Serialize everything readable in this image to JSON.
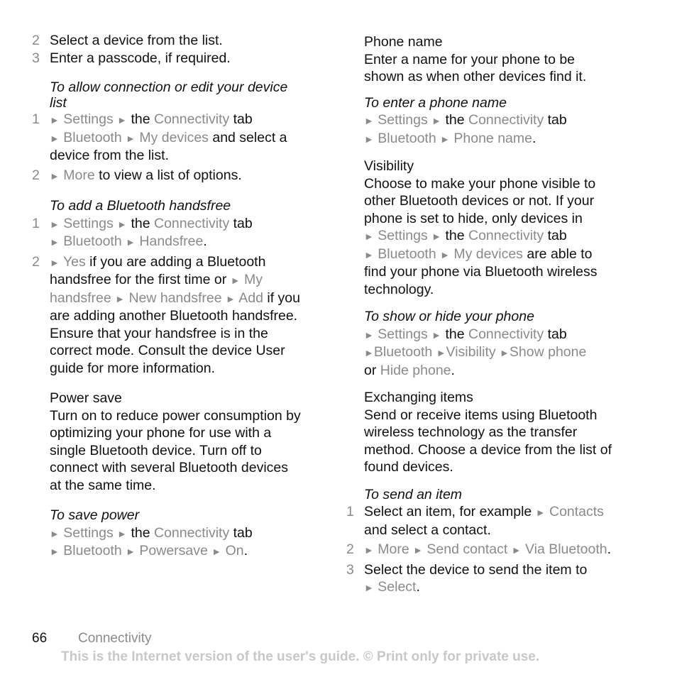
{
  "left": {
    "steps_intro": [
      {
        "num": "2",
        "text": "Select a device from the list."
      },
      {
        "num": "3",
        "text": "Enter a passcode, if required."
      }
    ],
    "allow_heading": "To allow connection or edit your device list",
    "allow_step1": {
      "num": "1",
      "settings": "Settings",
      "the": "the",
      "connectivity": "Connectivity",
      "tab": "tab",
      "bluetooth": "Bluetooth",
      "my_devices": "My devices",
      "rest": "and select a device from the list."
    },
    "allow_step2": {
      "num": "2",
      "more": "More",
      "rest": "to view a list of options."
    },
    "handsfree_heading": "To add a Bluetooth handsfree",
    "hf_step1": {
      "num": "1",
      "settings": "Settings",
      "the": "the",
      "connectivity": "Connectivity",
      "tab": "tab",
      "bluetooth": "Bluetooth",
      "handsfree": "Handsfree",
      "end": "."
    },
    "hf_step2": {
      "num": "2",
      "yes": "Yes",
      "t1": "if you are adding a Bluetooth handsfree for the first time or",
      "my_handsfree": "My handsfree",
      "new_handsfree": "New handsfree",
      "add": "Add",
      "t2": "if you are adding another Bluetooth handsfree. Ensure that your handsfree is in the correct mode. Consult the device User guide for more information."
    },
    "power_heading": "Power save",
    "power_text": "Turn on to reduce power consumption by optimizing your phone for use with a single Bluetooth device. Turn off to connect with several Bluetooth devices at the same time.",
    "save_heading": "To save power",
    "save_path": {
      "settings": "Settings",
      "the": "the",
      "connectivity": "Connectivity",
      "tab": "tab",
      "bluetooth": "Bluetooth",
      "powersave": "Powersave",
      "on": "On",
      "end": "."
    }
  },
  "right": {
    "phone_heading": "Phone name",
    "phone_text": "Enter a name for your phone to be shown as when other devices find it.",
    "enter_heading": "To enter a phone name",
    "enter_path": {
      "settings": "Settings",
      "the": "the",
      "connectivity": "Connectivity",
      "tab": "tab",
      "bluetooth": "Bluetooth",
      "phone_name": "Phone name",
      "end": "."
    },
    "vis_heading": "Visibility",
    "vis_text": "Choose to make your phone visible to other Bluetooth devices or not. If your phone is set to hide, only devices in",
    "vis_path": {
      "settings": "Settings",
      "the": "the",
      "connectivity": "Connectivity",
      "tab": "tab",
      "bluetooth": "Bluetooth",
      "my_devices": "My devices",
      "rest": "are able to find your phone via Bluetooth wireless technology."
    },
    "show_heading": "To show or hide your phone",
    "show_path": {
      "settings": "Settings",
      "the": "the",
      "connectivity": "Connectivity",
      "tab": "tab",
      "bluetooth": "Bluetooth",
      "visibility": "Visibility",
      "show_phone": "Show phone",
      "or": "or",
      "hide_phone": "Hide phone",
      "end": "."
    },
    "exch_heading": "Exchanging items",
    "exch_text": "Send or receive items using Bluetooth wireless technology as the transfer method. Choose a device from the list of found devices.",
    "send_heading": "To send an item",
    "send_step1": {
      "num": "1",
      "t1": "Select an item, for example",
      "contacts": "Contacts",
      "t2": "and select a contact."
    },
    "send_step2": {
      "num": "2",
      "more": "More",
      "send_contact": "Send contact",
      "via_bt": "Via Bluetooth",
      "end": "."
    },
    "send_step3": {
      "num": "3",
      "t1": "Select the device to send the item to",
      "select": "Select",
      "end": "."
    }
  },
  "footer": {
    "page_number": "66",
    "section": "Connectivity",
    "note": "This is the Internet version of the user's guide. © Print only for private use."
  },
  "icons": {
    "menu_arrow": "►"
  }
}
